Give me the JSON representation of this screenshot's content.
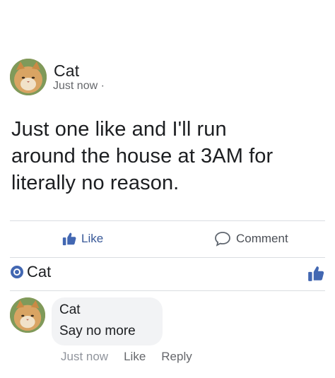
{
  "post": {
    "author": "Cat",
    "timestamp": "Just now",
    "privacy_separator": "·",
    "text_line_1": "Just one like and I'll run",
    "text_line_2": "around the house at 3AM for",
    "text_line_3": "literally no reason."
  },
  "actions": {
    "like_label": "Like",
    "comment_label": "Comment"
  },
  "reactions": {
    "reactor_name": "Cat"
  },
  "comment": {
    "author": "Cat",
    "text": "Say no more",
    "timestamp": "Just now",
    "like_label": "Like",
    "reply_label": "Reply"
  },
  "colors": {
    "accent": "#4267b2",
    "link_text": "#385898",
    "bubble_bg": "#f2f3f5",
    "muted_text": "#90949c"
  },
  "icons": {
    "like": "thumbs-up-icon",
    "comment": "speech-bubble-icon",
    "reaction_badge": "like-reaction-badge-icon",
    "liked": "thumbs-up-icon"
  }
}
